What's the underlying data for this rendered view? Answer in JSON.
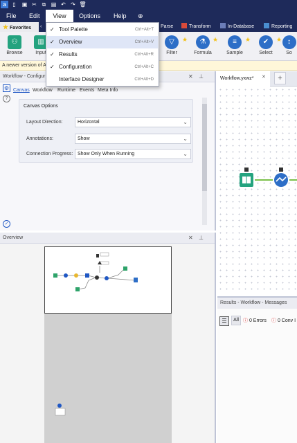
{
  "menu": {
    "file": "File",
    "edit": "Edit",
    "view": "View",
    "options": "Options",
    "help": "Help"
  },
  "ribbon_tabs": {
    "favorites": "Favorites",
    "parse": "Parse",
    "transform": "Transform",
    "in_database": "In-Database",
    "reporting": "Reporting"
  },
  "tools": [
    {
      "label": "Browse",
      "color": "#24a37f",
      "icon": "binoculars-icon"
    },
    {
      "label": "Input",
      "color": "#24a37f",
      "icon": "book-icon"
    },
    {
      "label": "Filter",
      "color": "#2d6ec7",
      "icon": "filter-icon"
    },
    {
      "label": "Formula",
      "color": "#2d6ec7",
      "icon": "flask-icon"
    },
    {
      "label": "Sample",
      "color": "#2d6ec7",
      "icon": "sample-icon"
    },
    {
      "label": "Select",
      "color": "#2d6ec7",
      "icon": "select-icon"
    },
    {
      "label": "So",
      "color": "#2d6ec7",
      "icon": "sort-icon"
    }
  ],
  "banner": "A newer version of Alt",
  "view_menu": [
    {
      "label": "Tool Palette",
      "shortcut": "Ctrl+Alt+T",
      "checked": true
    },
    {
      "label": "Overview",
      "shortcut": "Ctrl+Alt+V",
      "checked": true
    },
    {
      "label": "Results",
      "shortcut": "Ctrl+Alt+R",
      "checked": true
    },
    {
      "label": "Configuration",
      "shortcut": "Ctrl+Alt+C",
      "checked": true
    },
    {
      "label": "Interface Designer",
      "shortcut": "Ctrl+Alt+D",
      "checked": false
    }
  ],
  "config": {
    "title": "Workflow - Configur",
    "tabs": [
      "Canvas",
      "Workflow",
      "Runtime",
      "Events",
      "Meta Info"
    ],
    "group_title": "Canvas Options",
    "fields": [
      {
        "label": "Layout Direction:",
        "value": "Horizontal"
      },
      {
        "label": "Annotations:",
        "value": "Show"
      },
      {
        "label": "Connection Progress:",
        "value": "Show Only When Running"
      }
    ]
  },
  "overview": {
    "title": "Overview"
  },
  "workflow": {
    "tab": "Workflow.yxwz*",
    "add": "+"
  },
  "results": {
    "title": "Results - Workflow - Messages",
    "all": "All",
    "errors": "0 Errors",
    "conv": "0 Conv I"
  }
}
